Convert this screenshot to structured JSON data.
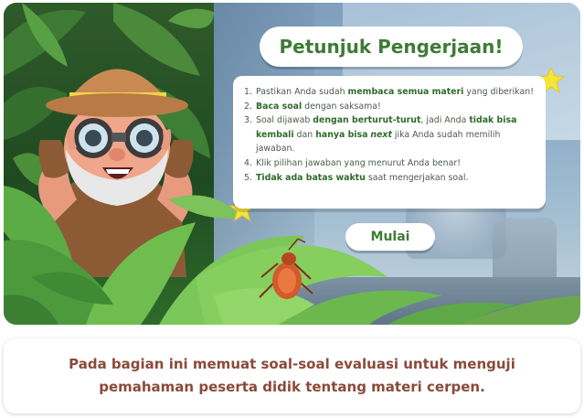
{
  "header": {
    "title": "Petunjuk Pengerjaan!"
  },
  "instructions": [
    {
      "num": "1.",
      "parts": [
        {
          "t": "Pastikan Anda sudah ",
          "s": "n"
        },
        {
          "t": "membaca semua materi",
          "s": "b"
        },
        {
          "t": " yang diberikan!",
          "s": "n"
        }
      ]
    },
    {
      "num": "2.",
      "parts": [
        {
          "t": "Baca soal",
          "s": "b"
        },
        {
          "t": " dengan saksama!",
          "s": "n"
        }
      ]
    },
    {
      "num": "3.",
      "parts": [
        {
          "t": "Soal dijawab ",
          "s": "n"
        },
        {
          "t": "dengan berturut-turut",
          "s": "b"
        },
        {
          "t": ", jadi Anda ",
          "s": "n"
        },
        {
          "t": "tidak bisa kembali",
          "s": "b"
        },
        {
          "t": " dan ",
          "s": "n"
        },
        {
          "t": "hanya bisa",
          "s": "b"
        },
        {
          "t": " ",
          "s": "n"
        },
        {
          "t": "next",
          "s": "i"
        },
        {
          "t": " jika Anda sudah memilih jawaban.",
          "s": "n"
        }
      ]
    },
    {
      "num": "4.",
      "parts": [
        {
          "t": "Klik pilihan jawaban yang menurut Anda benar!",
          "s": "n"
        }
      ]
    },
    {
      "num": "5.",
      "parts": [
        {
          "t": "Tidak ada batas waktu",
          "s": "b"
        },
        {
          "t": " saat mengerjakan soal.",
          "s": "n"
        }
      ]
    }
  ],
  "start_button": {
    "label": "Mulai"
  },
  "caption": {
    "text": "Pada bagian ini memuat soal-soal evaluasi untuk menguji pemahaman peserta didik tentang materi cerpen."
  },
  "colors": {
    "accent_green": "#3f7a36",
    "caption_brown": "#8a4a3a",
    "star_yellow": "#f5e43a"
  },
  "icons": [
    "explorer-character-illustration",
    "binoculars-icon",
    "star-icon",
    "beetle-illustration"
  ]
}
